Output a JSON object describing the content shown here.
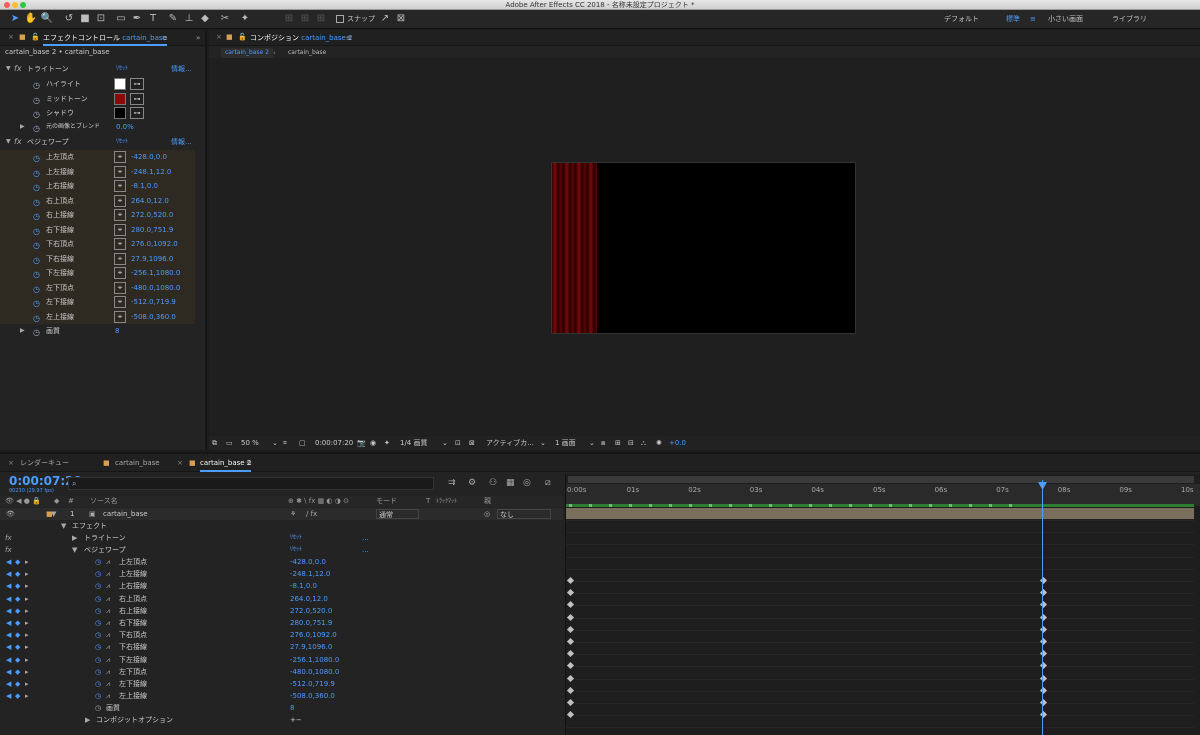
{
  "app_title": "Adobe After Effects CC 2018 - 名称未設定プロジェクト *",
  "toolbar": {
    "snap_label": "スナップ",
    "workspaces": [
      {
        "label": "デフォルト"
      },
      {
        "label": "標準"
      },
      {
        "label": "小さい画面"
      },
      {
        "label": "ライブラリ"
      }
    ],
    "workspace_menu_icon": "≡"
  },
  "fx_panel": {
    "tab_label": "エフェクトコントロール",
    "tab_comp": "cartain_base",
    "menu": "≡",
    "breadcrumb": "cartain_base 2 • cartain_base",
    "tritone": {
      "name": "トライトーン",
      "reset": "ﾘｾｯﾄ",
      "about": "情報...",
      "rows": [
        {
          "label": "ハイライト",
          "color": "#ffffff"
        },
        {
          "label": "ミッドトーン",
          "color": "#8a0a0a"
        },
        {
          "label": "シャドウ",
          "color": "#000000"
        }
      ],
      "blend_label": "元の画像とブレンド",
      "blend_value": "0.0%"
    },
    "bezier": {
      "name": "ベジェワープ",
      "reset": "ﾘｾｯﾄ",
      "about": "情報...",
      "rows": [
        {
          "label": "上左頂点",
          "value": "-428.0,0.0"
        },
        {
          "label": "上左接線",
          "value": "-248.1,12.0"
        },
        {
          "label": "上右接線",
          "value": "-8.1,0.0"
        },
        {
          "label": "右上頂点",
          "value": "264.0,12.0"
        },
        {
          "label": "右上接線",
          "value": "272.0,520.0"
        },
        {
          "label": "右下接線",
          "value": "280.0,751.9"
        },
        {
          "label": "下右頂点",
          "value": "276.0,1092.0"
        },
        {
          "label": "下右接線",
          "value": "27.9,1096.0"
        },
        {
          "label": "下左接線",
          "value": "-256.1,1080.0"
        },
        {
          "label": "左下頂点",
          "value": "-480.0,1080.0"
        },
        {
          "label": "左下接線",
          "value": "-512.0,719.9"
        },
        {
          "label": "左上接線",
          "value": "-508.0,360.0"
        }
      ],
      "quality_label": "画質",
      "quality_value": "8"
    }
  },
  "comp_panel": {
    "tab_label": "コンポジション",
    "tab_comp": "cartain_base 2",
    "menu": "≡",
    "crumbs": [
      "cartain_base 2",
      "cartain_base"
    ],
    "footer": {
      "zoom": "50 %",
      "time": "0:00:07:20",
      "resolution": "1/4 画質",
      "camera": "アクティブカ...",
      "views": "1 画面",
      "offset": "+0.0"
    }
  },
  "timeline": {
    "tabs": [
      {
        "label": "レンダーキュー"
      },
      {
        "label": "cartain_base"
      },
      {
        "label": "cartain_base 2"
      }
    ],
    "timecode": "0:00:07:20",
    "fps": "00230 (29.97 fps)",
    "search_icon": "⌕",
    "columns": {
      "source": "ソース名",
      "switches": "⊕ ✱ \\ fx ▦ ◐ ◑ ⊙",
      "mode": "モード",
      "t": "T",
      "track": "ﾄﾗｯｸﾏｯﾄ",
      "parent": "親"
    },
    "layer": {
      "index": "1",
      "name": "cartain_base",
      "mode": "通常",
      "parent": "なし"
    },
    "effects_label": "エフェクト",
    "tritone_label": "トライトーン",
    "bezier_label": "ベジェワープ",
    "reset": "ﾘｾｯﾄ",
    "dots": "...",
    "quality_label": "画質",
    "quality_value": "8",
    "composite_label": "コンポジットオプション",
    "composite_value": "+−",
    "ruler": [
      "0:00s",
      "01s",
      "02s",
      "03s",
      "04s",
      "05s",
      "06s",
      "07s",
      "08s",
      "09s",
      "10s"
    ]
  }
}
